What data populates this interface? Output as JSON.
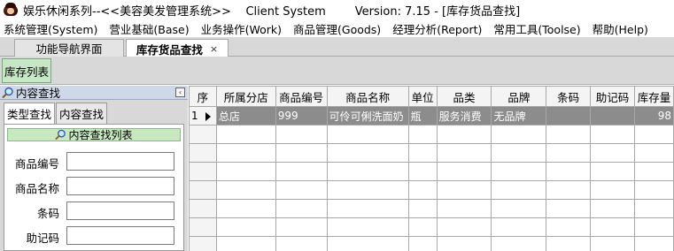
{
  "window": {
    "title": "娱乐休闲系列--<<美容美发管理系统>>    Client System        Version: 7.15 - [库存货品查找]"
  },
  "menu": [
    "系统管理(System)",
    "营业基础(Base)",
    "业务操作(Work)",
    "商品管理(Goods)",
    "经理分析(Report)",
    "常用工具(Toolse)",
    "帮助(Help)"
  ],
  "tabs": {
    "nav_label": "功能导航界面",
    "active_label": "库存货品查找",
    "close_glyph": "×"
  },
  "toolbar": {
    "inventory_list_label": "库存列表"
  },
  "left_panel": {
    "header_label": "内容查找",
    "collapse_glyph": "‹",
    "tab_type": "类型查找",
    "tab_content": "内容查找",
    "list_header": "内容查找列表",
    "fields": {
      "product_code_label": "商品编号",
      "product_code_value": "",
      "product_name_label": "商品名称",
      "product_name_value": "",
      "barcode_label": "条码",
      "barcode_value": "",
      "mnemonic_label": "助记码",
      "mnemonic_value": ""
    }
  },
  "grid": {
    "columns": [
      "序",
      "所属分店",
      "商品编号",
      "商品名称",
      "单位",
      "品类",
      "品牌",
      "条码",
      "助记码",
      "库存量"
    ],
    "rows": [
      [
        "1",
        "总店",
        "999",
        "可伶可俐洗面奶",
        "瓶",
        "服务消费",
        "无品牌",
        "",
        "",
        "98"
      ]
    ],
    "selected_row": 0
  },
  "colors": {
    "selected_row_bg": "#8c8c8c",
    "inventory_button_bg": "#c6e6c6",
    "panel_header_bg": "#cfd8e8"
  }
}
